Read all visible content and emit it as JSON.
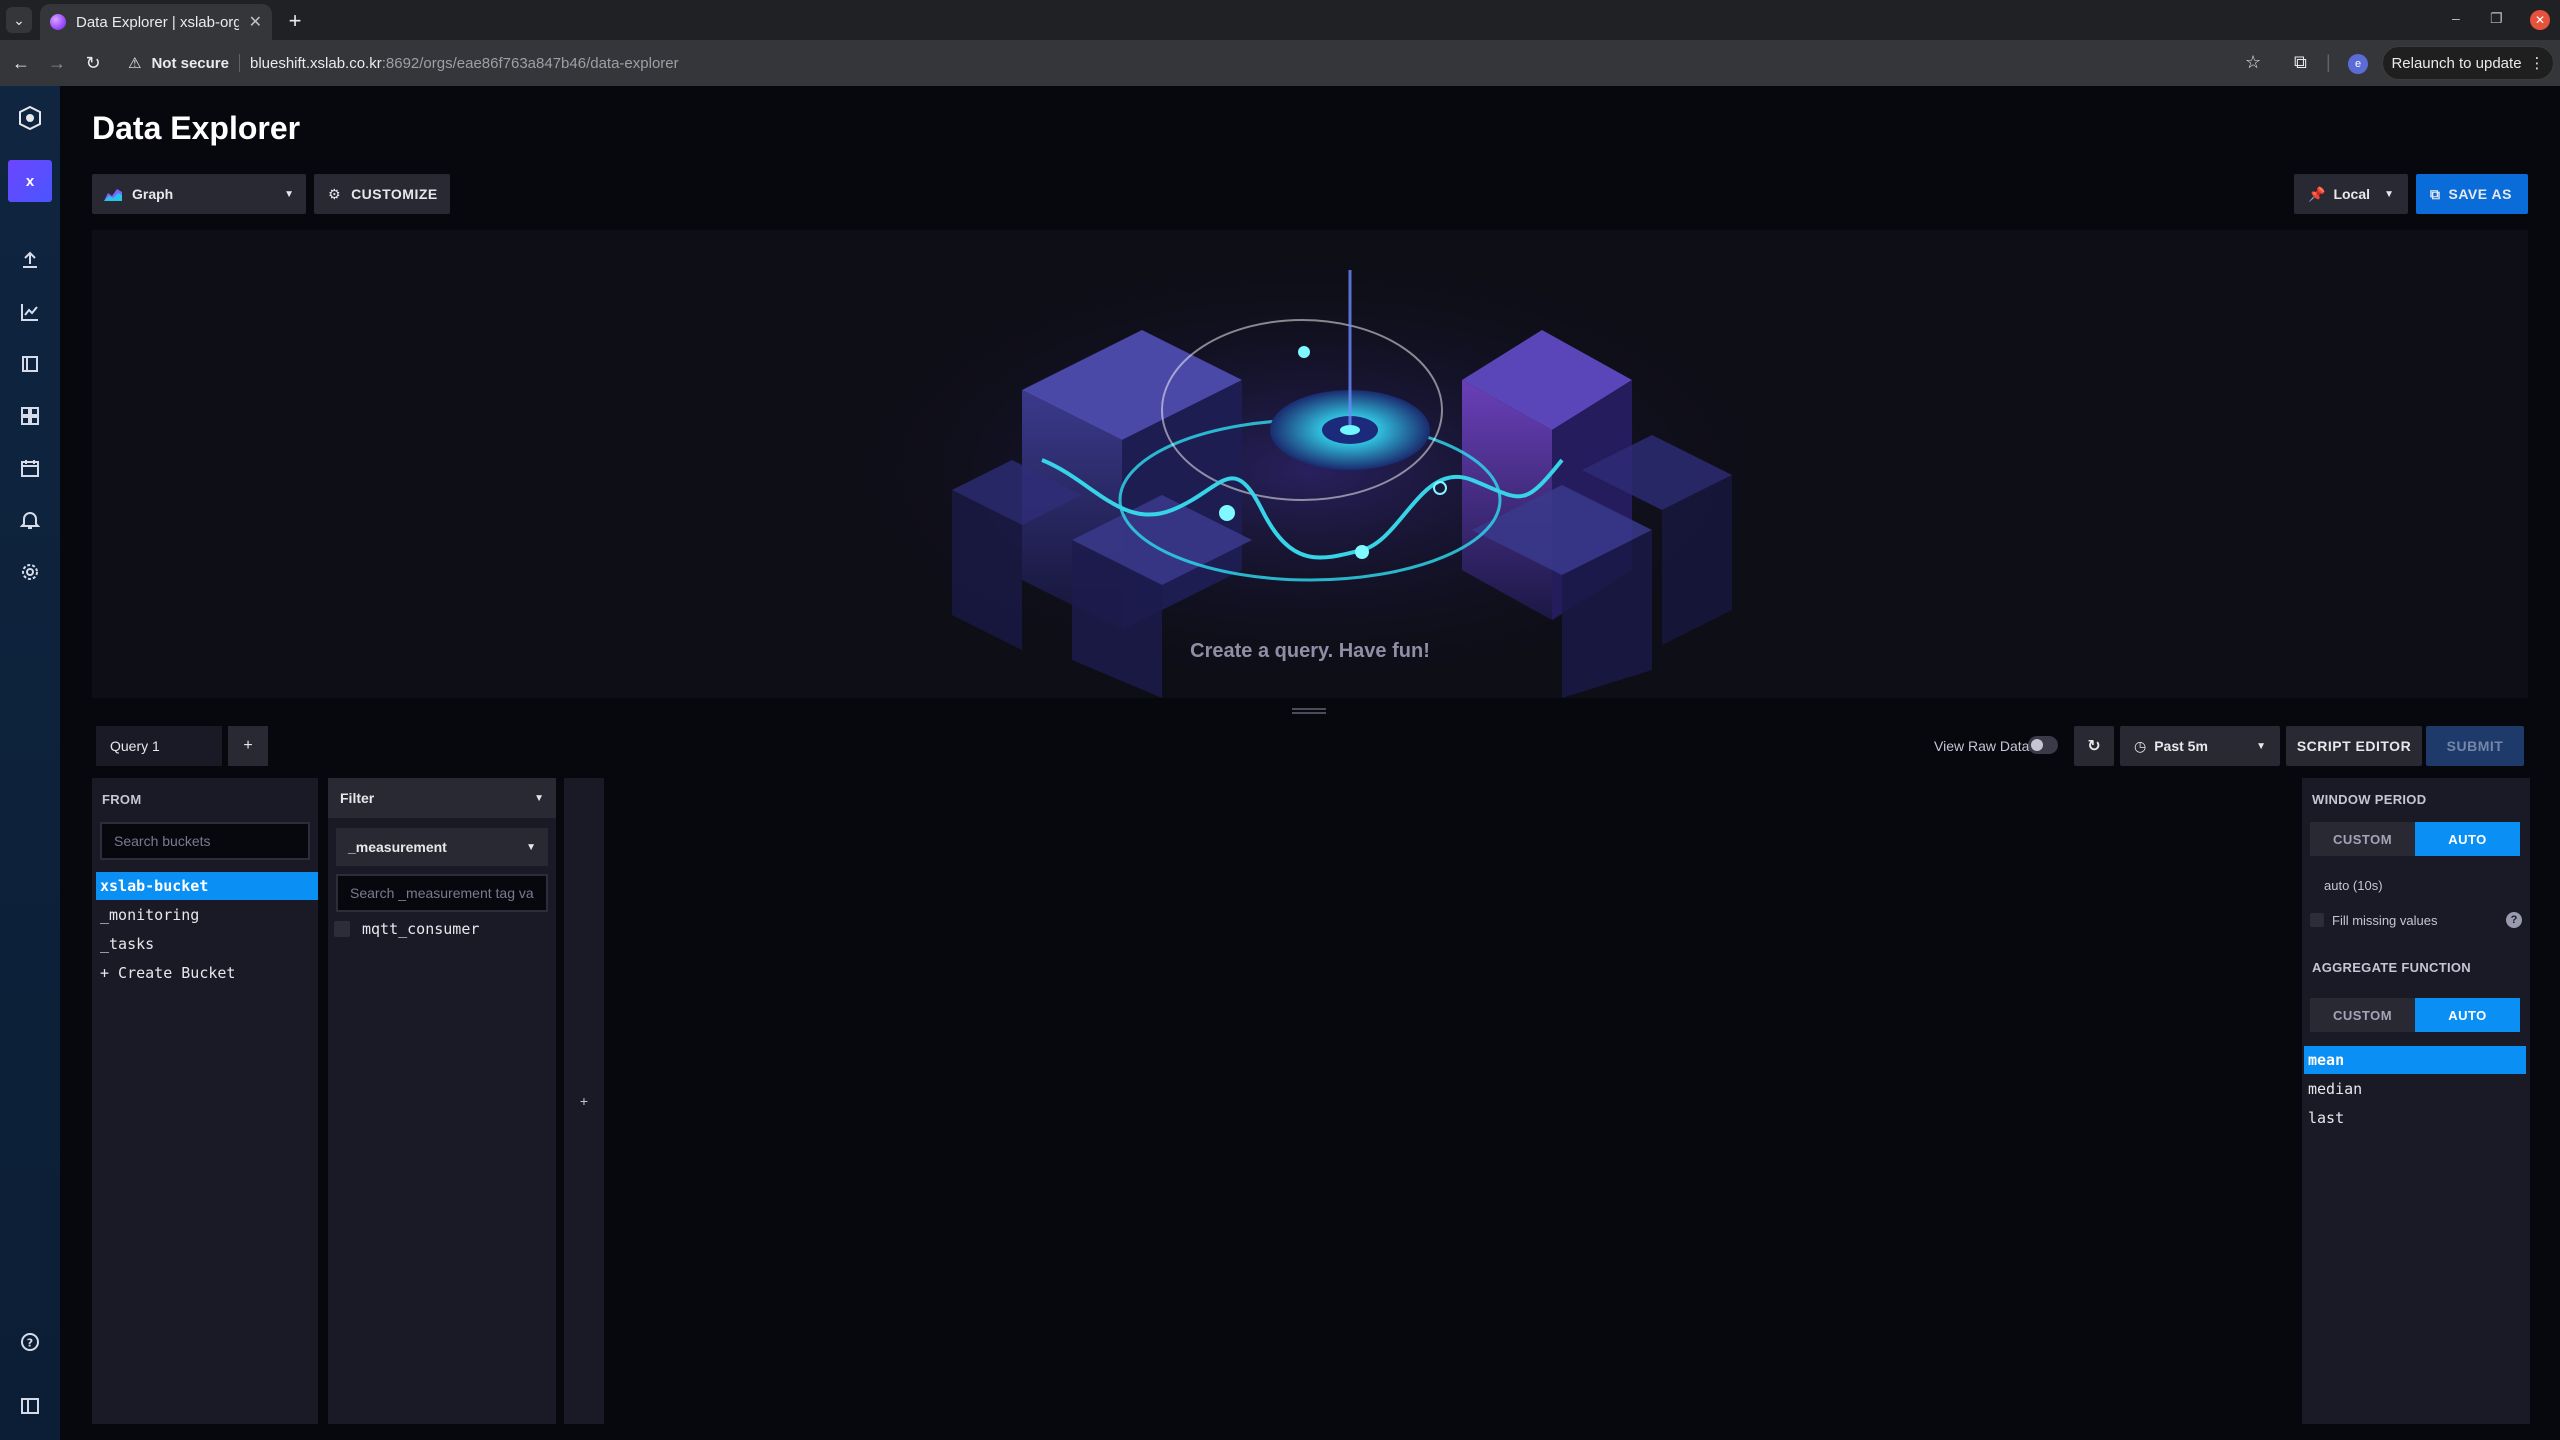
{
  "browser": {
    "tab_title": "Data Explorer | xslab-org",
    "security_label": "Not secure",
    "url_host": "blueshift.xslab.co.kr",
    "url_path": ":8692/orgs/eae86f763a847b46/data-explorer",
    "relaunch_label": "Relaunch to update",
    "profile_initial": "e"
  },
  "sidebar": {
    "org_initial": "x",
    "items": [
      "upload-icon",
      "graph-icon",
      "notebook-icon",
      "dashboards-icon",
      "tasks-icon",
      "alerts-icon",
      "settings-icon"
    ],
    "help": "help-icon",
    "collapse": "collapse-icon"
  },
  "page": {
    "title": "Data Explorer"
  },
  "toolbar": {
    "viz_type": "Graph",
    "customize_label": "CUSTOMIZE",
    "timezone_label": "Local",
    "save_as_label": "SAVE AS"
  },
  "graph": {
    "empty_message": "Create a query. Have fun!"
  },
  "query_bar": {
    "query_tab": "Query 1",
    "add_label": "+",
    "view_raw_label": "View Raw Data",
    "view_raw_enabled": false,
    "time_range": "Past 5m",
    "script_editor_label": "SCRIPT EDITOR",
    "submit_label": "SUBMIT"
  },
  "from": {
    "header": "FROM",
    "search_placeholder": "Search buckets",
    "buckets": [
      "xslab-bucket",
      "_monitoring",
      "_tasks",
      "+ Create Bucket"
    ],
    "selected_index": 0
  },
  "filter": {
    "header": "Filter",
    "key": "_measurement",
    "search_placeholder": "Search _measurement tag va",
    "values": [
      "mqtt_consumer"
    ]
  },
  "add_filter": {
    "label": "+"
  },
  "window_period": {
    "header": "WINDOW PERIOD",
    "custom_label": "CUSTOM",
    "auto_label": "AUTO",
    "auto_value": "auto (10s)",
    "fill_missing_label": "Fill missing values",
    "help_label": "?"
  },
  "aggregate": {
    "header": "AGGREGATE FUNCTION",
    "custom_label": "CUSTOM",
    "auto_label": "AUTO",
    "functions": [
      "mean",
      "median",
      "last"
    ],
    "selected_index": 0
  },
  "colors": {
    "accent_blue": "#0a8ff5",
    "save_blue": "#0a6cd9",
    "background": "#07070e",
    "panel": "#1a1a26"
  }
}
